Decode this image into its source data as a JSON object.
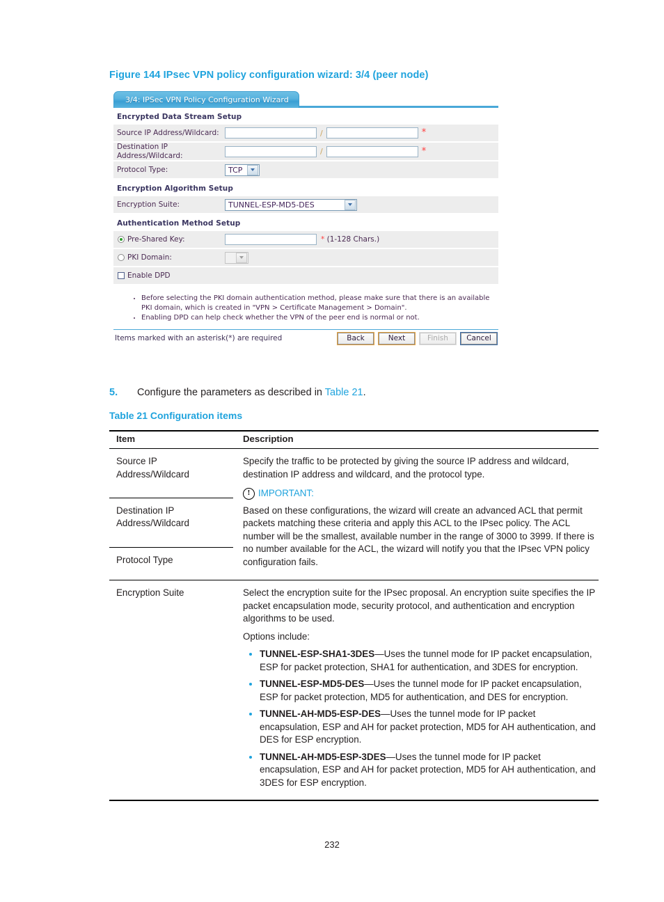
{
  "figure": {
    "caption": "Figure 144 IPsec VPN policy configuration wizard: 3/4 (peer node)",
    "tab_label": "3/4: IPSec VPN Policy Configuration Wizard",
    "sections": {
      "encrypted_data_stream": "Encrypted Data Stream Setup",
      "encryption_algorithm": "Encryption Algorithm Setup",
      "authentication_method": "Authentication Method Setup"
    },
    "fields": {
      "source_ip_label": "Source IP Address/Wildcard:",
      "source_ip_value": "",
      "source_wildcard_value": "",
      "destination_ip_label": "Destination IP Address/Wildcard:",
      "destination_ip_value": "",
      "destination_wildcard_value": "",
      "separator": "/",
      "protocol_type_label": "Protocol Type:",
      "protocol_type_value": "TCP",
      "encryption_suite_label": "Encryption Suite:",
      "encryption_suite_value": "TUNNEL-ESP-MD5-DES",
      "pre_shared_key_label": "Pre-Shared Key:",
      "pre_shared_key_value": "",
      "pre_shared_key_hint": "(1-128 Chars.)",
      "pre_shared_key_hint_star": "•",
      "pki_domain_label": "PKI Domain:",
      "pki_domain_value": "",
      "enable_dpd_label": "Enable DPD"
    },
    "notes": [
      "Before selecting the PKI domain authentication method, please make sure that there is an available PKI domain, which is created in \"VPN > Certificate Management > Domain\".",
      "Enabling DPD can help check whether the VPN of the peer end is normal or not."
    ],
    "footer_note": "Items marked with an asterisk(*) are required",
    "buttons": {
      "back": "Back",
      "next": "Next",
      "finish": "Finish",
      "cancel": "Cancel"
    },
    "colors": {
      "tab_blue": "#49a8d8",
      "required_red": "#ff3d3d",
      "button_focus_orange": "#e8a33d",
      "cancel_border_blue": "#3f6fa8"
    }
  },
  "step": {
    "number": "5.",
    "text_before": "Configure the parameters as described in ",
    "link": "Table 21",
    "text_after": "."
  },
  "table": {
    "caption": "Table 21 Configuration items",
    "headers": {
      "item": "Item",
      "description": "Description"
    },
    "rows": [
      {
        "item": "Source IP Address/Wildcard"
      },
      {
        "item": "Destination IP Address/Wildcard"
      },
      {
        "item": "Protocol Type"
      },
      {
        "item": "Encryption Suite"
      }
    ],
    "group1_description": {
      "intro": "Specify the traffic to be protected by giving the source IP address and wildcard, destination IP address and wildcard, and the protocol type.",
      "important_label": "IMPORTANT:",
      "important_body": "Based on these configurations, the wizard will create an advanced ACL that permit packets matching these criteria and apply this ACL to the IPsec policy. The ACL number will be the smallest, available number in the range of 3000 to 3999. If there is no number available for the ACL, the wizard will notify you that the IPsec VPN policy configuration fails."
    },
    "group2_description": {
      "intro": "Select the encryption suite for the IPsec proposal. An encryption suite specifies the IP packet encapsulation mode, security protocol, and authentication and encryption algorithms to be used.",
      "options_label": "Options include:",
      "options": [
        {
          "name": "TUNNEL-ESP-SHA1-3DES",
          "desc": "—Uses the tunnel mode for IP packet encapsulation, ESP for packet protection, SHA1 for authentication, and 3DES for encryption."
        },
        {
          "name": "TUNNEL-ESP-MD5-DES",
          "desc": "—Uses the tunnel mode for IP packet encapsulation, ESP for packet protection, MD5 for authentication, and DES for encryption."
        },
        {
          "name": "TUNNEL-AH-MD5-ESP-DES",
          "desc": "—Uses the tunnel mode for IP packet encapsulation, ESP and AH for packet protection, MD5 for AH authentication, and DES for ESP encryption."
        },
        {
          "name": "TUNNEL-AH-MD5-ESP-3DES",
          "desc": "—Uses the tunnel mode for IP packet encapsulation, ESP and AH for packet protection, MD5 for AH authentication, and 3DES for ESP encryption."
        }
      ]
    }
  },
  "page_number": "232"
}
